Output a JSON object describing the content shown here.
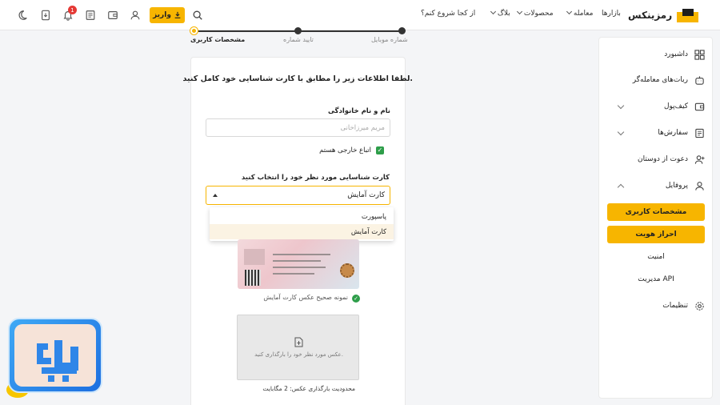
{
  "header": {
    "brand": "رمزینکس",
    "nav": [
      "بازارها",
      "معامله",
      "محصولات",
      "بلاگ",
      "از کجا شروع کنم؟"
    ],
    "deposit_label": "واریز",
    "notification_count": "1",
    "icons": [
      "search-icon",
      "bell-icon",
      "wallet-download-icon",
      "receipt-icon",
      "wallet-icon",
      "user-icon",
      "moon-icon"
    ]
  },
  "sidebar": {
    "items": [
      {
        "label": "داشبورد",
        "icon": "grid-icon"
      },
      {
        "label": "ربات‌های معامله‌گر",
        "icon": "robot-icon"
      },
      {
        "label": "کیف‌پول",
        "icon": "wallet-icon"
      },
      {
        "label": "سفارش‌ها",
        "icon": "orders-icon"
      },
      {
        "label": "دعوت از دوستان",
        "icon": "user-add-icon"
      },
      {
        "label": "پروفایل",
        "icon": "user-icon"
      }
    ],
    "profile_sub": [
      "مشخصات کاربری",
      "احراز هویت"
    ],
    "profile_plain": [
      "امنیت",
      "مدیریت API"
    ],
    "settings_label": "تنظیمات"
  },
  "stepper": {
    "steps": [
      "مشخصات کاربری",
      "تایید شماره",
      "شماره موبایل"
    ]
  },
  "form": {
    "intro": "لطفا اطلاعات زیر را مطابق با کارت شناسایی خود کامل کنید.",
    "name_label": "نام و نام خانوادگی",
    "name_placeholder": "مریم میرزاخانی",
    "foreign_label": "اتباع خارجی هستم",
    "id_label": "کارت شناسایی مورد نظر خود را انتخاب کنید",
    "id_selected": "کارت آمایش",
    "id_options": [
      "پاسپورت",
      "کارت آمایش"
    ],
    "sample_caption": "نمونه صحیح عکس کارت آمایش",
    "upload_text": "عکس مورد نظر خود را بارگذاری کنید.",
    "upload_limit": "محدودیت بارگذاری عکس: 2 مگابایت"
  },
  "colors": {
    "accent": "#f7b500",
    "success": "#2e9e4a",
    "danger": "#e53935"
  }
}
